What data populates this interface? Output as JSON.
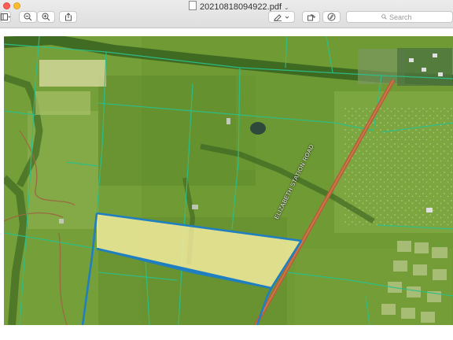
{
  "window": {
    "title": "20210818094922.pdf",
    "close_color": "#ff5f57",
    "minimize_color": "#febc2e"
  },
  "toolbar": {
    "buttons": [
      {
        "name": "sidebar-toggle",
        "icon": "sidebar-icon"
      },
      {
        "name": "zoom-out",
        "icon": "zoom-out-icon"
      },
      {
        "name": "zoom-in",
        "icon": "zoom-in-icon"
      },
      {
        "name": "share",
        "icon": "share-icon"
      },
      {
        "name": "markup",
        "icon": "pen-icon"
      },
      {
        "name": "rotate",
        "icon": "rotate-icon"
      },
      {
        "name": "annotate",
        "icon": "markup-circle-icon"
      }
    ],
    "search_placeholder": "Search"
  },
  "map": {
    "road_label": "ELIZABETH STATION ROAD",
    "colors": {
      "field": "#6f9a34",
      "parcel_line": "#2bbf8a",
      "parcel_highlight": "#fff3a6",
      "parcel_outline": "#1f7fc0",
      "road": "#b8603a"
    }
  }
}
